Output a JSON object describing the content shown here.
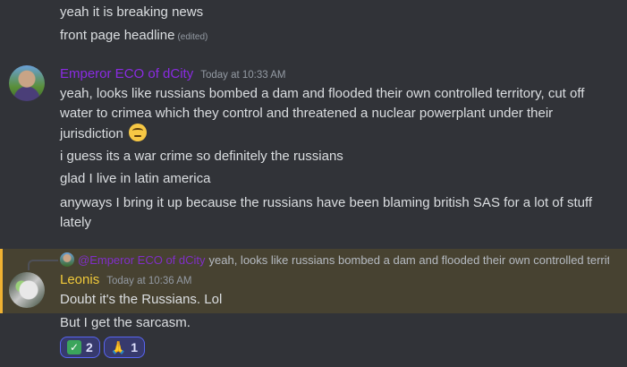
{
  "messages_before": [
    {
      "text": "yeah it is breaking news"
    },
    {
      "text": "front page headline",
      "edited": "(edited)"
    }
  ],
  "emperor_group": {
    "username": "Emperor ECO of dCity",
    "timestamp": "Today at 10:33 AM",
    "messages": [
      {
        "text": "yeah, looks like russians bombed a dam and flooded their own controlled territory, cut off water to crimea which they control and threatened a nuclear powerplant under their jurisdiction",
        "emoji": "rolling-eyes-emoji"
      },
      {
        "text": "i guess its a war crime so definitely the russians"
      },
      {
        "text": "glad I live in latin america"
      },
      {
        "text": "anyways I bring it up because the russians have been blaming british SAS for a lot of stuff lately"
      }
    ]
  },
  "reply_preview": {
    "mention": "@Emperor ECO of dCity",
    "text": "yeah, looks like russians bombed a dam and flooded their own controlled territory, cut off water to crimea which they control and threatened a nuclear powerplant under their jurisdiction"
  },
  "leonis_group": {
    "username": "Leonis",
    "timestamp": "Today at 10:36 AM",
    "messages": [
      {
        "text": "Doubt it's the Russians. Lol"
      },
      {
        "text": "But I get the sarcasm."
      }
    ],
    "reactions": [
      {
        "icon": "check-mark-icon",
        "glyph": "✓",
        "count": "2"
      },
      {
        "icon": "folded-hands-icon",
        "glyph": "🙏",
        "count": "1"
      }
    ]
  },
  "colors": {
    "background": "#313338",
    "text": "#dbdee1",
    "emperor_name": "#8a2be2",
    "leonis_name": "#f0c93a",
    "mention_highlight": "#474231",
    "reaction_border": "#5865f2"
  }
}
